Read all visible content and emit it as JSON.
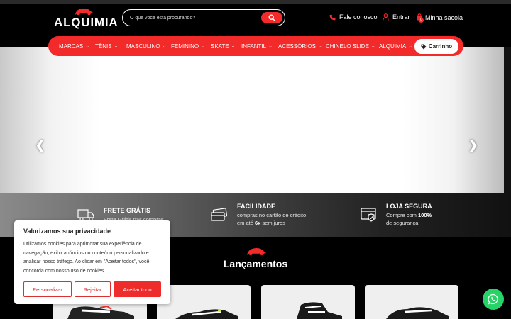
{
  "header": {
    "logo_text": "ALQUIMIA",
    "search_placeholder": "O que você está procurando?",
    "fale_conosco": "Fale conosco",
    "entrar": "Entrar",
    "minha_sacola": "Minha sacola",
    "cart_count": "0"
  },
  "nav": {
    "items": [
      {
        "label": "MARCAS"
      },
      {
        "label": "TÊNIS"
      },
      {
        "label": "MASCULINO"
      },
      {
        "label": "FEMININO"
      },
      {
        "label": "SKATE"
      },
      {
        "label": "INFANTIL"
      },
      {
        "label": "ACESSÓRIOS"
      },
      {
        "label": "CHINELO SLIDE"
      },
      {
        "label": "ALQUIMIA"
      }
    ],
    "cart_label": "Carrinho"
  },
  "features": [
    {
      "title": "FRETE GRÁTIS",
      "line1": "Frete Grátis nas compras",
      "line2": ""
    },
    {
      "title": "FACILIDADE",
      "line1": "compras no cartão de crédito",
      "line2_pre": "em até ",
      "line2_bold": "6x",
      "line2_post": " sem juros"
    },
    {
      "title": "LOJA SEGURA",
      "line1_pre": "Compre com ",
      "line1_bold": "100%",
      "line2": "de segurança"
    }
  ],
  "section": {
    "title": "Lançamentos"
  },
  "cookie": {
    "title": "Valorizamos sua privacidade",
    "text": "Utilizamos cookies para aprimorar sua experiência de navegação, exibir anúncios ou conteúdo personalizado e analisar nosso tráfego. Ao clicar em \"Aceitar todos\", você concorda com nosso uso de cookies.",
    "btn_customize": "Personalizar",
    "btn_reject": "Rejeitar",
    "btn_accept": "Aceitar tudo"
  },
  "colors": {
    "accent": "#f22a2a",
    "whatsapp": "#25d366",
    "background": "#000000"
  }
}
